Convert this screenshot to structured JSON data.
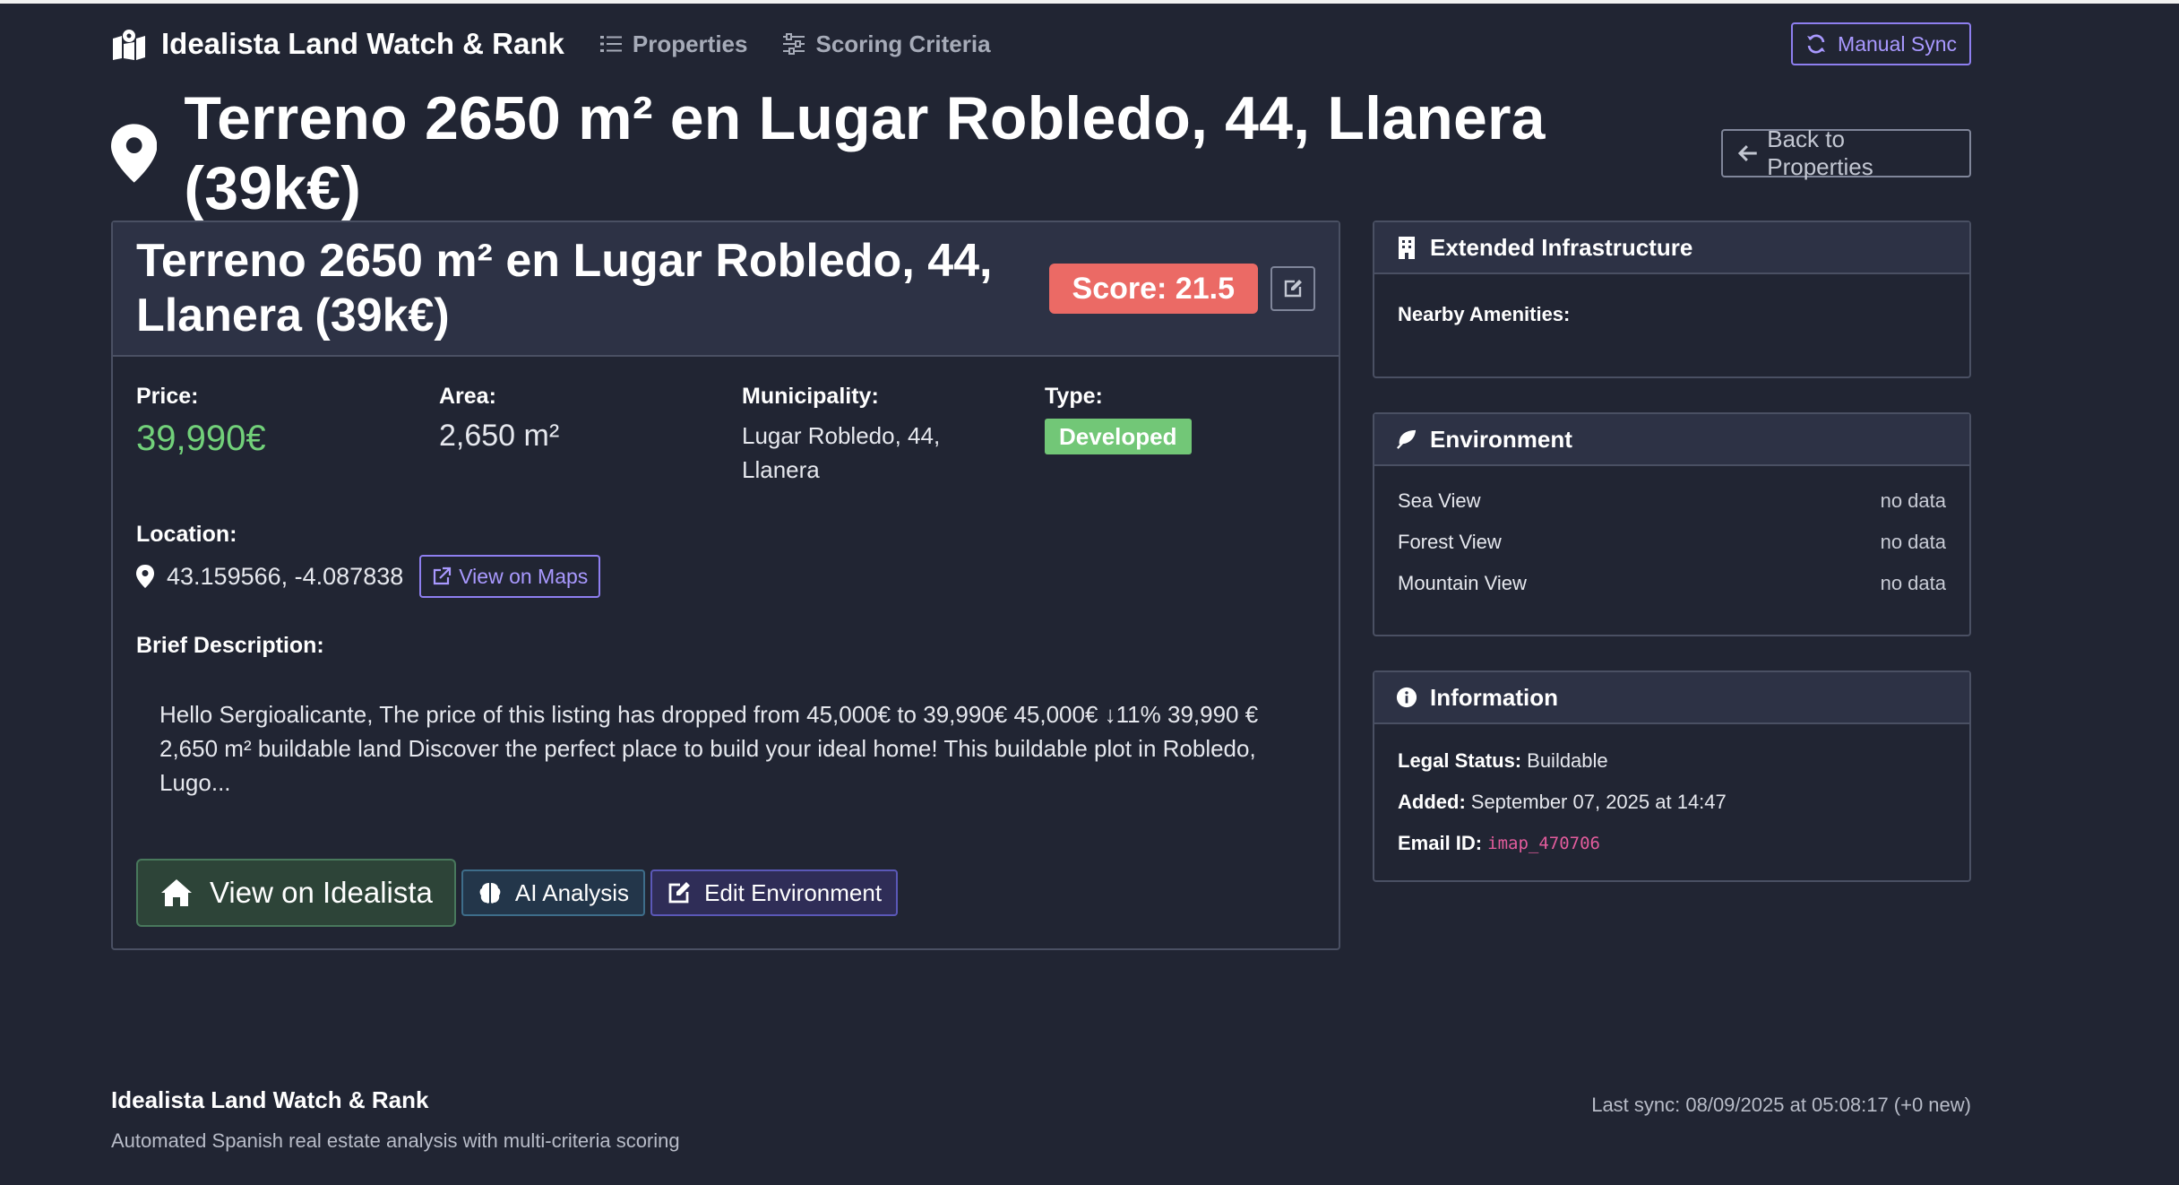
{
  "navbar": {
    "brand": "Idealista Land Watch & Rank",
    "links": [
      {
        "label": "Properties",
        "icon": "list-icon"
      },
      {
        "label": "Scoring Criteria",
        "icon": "sliders-icon"
      }
    ],
    "sync_label": "Manual Sync"
  },
  "header": {
    "title": "Terreno 2650 m² en Lugar Robledo, 44, Llanera (39k€)",
    "back_label": "Back to Properties"
  },
  "property": {
    "title": "Terreno 2650 m² en Lugar Robledo, 44, Llanera (39k€)",
    "score_label": "Score: 21.5",
    "price_label": "Price:",
    "price": "39,990€",
    "area_label": "Area:",
    "area": "2,650 m²",
    "municipality_label": "Municipality:",
    "municipality": "Lugar Robledo, 44, Llanera",
    "type_label": "Type:",
    "type": "Developed",
    "location_label": "Location:",
    "coordinates": "43.159566, -4.087838",
    "maps_label": "View on Maps",
    "description_label": "Brief Description:",
    "description": "Hello Sergioalicante, The price of this listing has dropped from 45,000€ to 39,990€ 45,000€ ↓11% 39,990 € 2,650 m² buildable land Discover the perfect place to build your ideal home! This buildable plot in Robledo, Lugo...",
    "actions": {
      "idealista": "View on Idealista",
      "ai": "AI Analysis",
      "environment": "Edit Environment"
    }
  },
  "infrastructure": {
    "title": "Extended Infrastructure",
    "amenities_label": "Nearby Amenities:"
  },
  "environment": {
    "title": "Environment",
    "rows": [
      {
        "label": "Sea View",
        "value": "no data"
      },
      {
        "label": "Forest View",
        "value": "no data"
      },
      {
        "label": "Mountain View",
        "value": "no data"
      }
    ]
  },
  "information": {
    "title": "Information",
    "legal_label": "Legal Status:",
    "legal_value": "Buildable",
    "added_label": "Added:",
    "added_value": "September 07, 2025 at 14:47",
    "email_label": "Email ID:",
    "email_value": "imap_470706"
  },
  "footer": {
    "brand": "Idealista Land Watch & Rank",
    "tagline": "Automated Spanish real estate analysis with multi-criteria scoring",
    "last_sync": "Last sync: 08/09/2025 at 05:08:17 (+0 new)"
  },
  "colors": {
    "background": "#212533",
    "score": "#eb6a65",
    "price": "#72d17a",
    "type_badge": "#72c777",
    "accent": "#8e7ff0",
    "email_code": "#e35c9c"
  }
}
